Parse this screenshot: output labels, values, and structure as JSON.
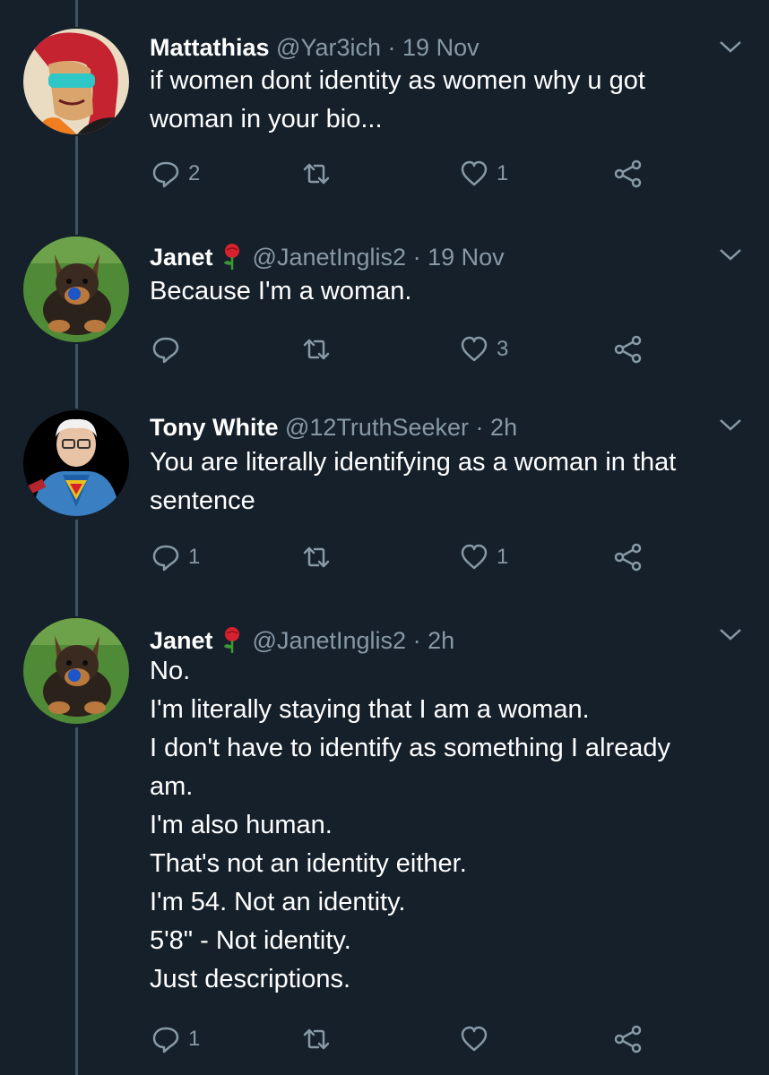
{
  "colors": {
    "background": "#15202b",
    "secondary_text": "#8899a6",
    "thread_line": "#3d5466",
    "primary_text": "#ffffff"
  },
  "tweets": [
    {
      "name": "Mattathias",
      "handle": "@Yar3ich",
      "separator": "·",
      "time": "19 Nov",
      "has_rose": false,
      "avatar": "cartoon-woman-sunglasses-avatar",
      "lines": [
        "if women dont identity as women why u got",
        "woman in your bio..."
      ],
      "actions": {
        "reply_count": "2",
        "retweet_count": "",
        "like_count": "1"
      }
    },
    {
      "name": "Janet",
      "handle": "@JanetInglis2",
      "separator": "·",
      "time": "19 Nov",
      "has_rose": true,
      "avatar": "dog-on-grass-avatar",
      "lines": [
        "Because I'm a woman."
      ],
      "actions": {
        "reply_count": "",
        "retweet_count": "",
        "like_count": "3"
      }
    },
    {
      "name": "Tony White",
      "handle": "@12TruthSeeker",
      "separator": "·",
      "time": "2h",
      "has_rose": false,
      "avatar": "old-man-superman-shirt-avatar",
      "lines": [
        "You are literally identifying as a woman in that",
        "sentence"
      ],
      "actions": {
        "reply_count": "1",
        "retweet_count": "",
        "like_count": "1"
      }
    },
    {
      "name": "Janet",
      "handle": "@JanetInglis2",
      "separator": "·",
      "time": "2h",
      "has_rose": true,
      "avatar": "dog-on-grass-avatar",
      "lines": [
        "No.",
        "I'm literally staying that I am a woman.",
        "I don't have to identify as something I already",
        "am.",
        "I'm also human.",
        "That's not an identity either.",
        "I'm 54. Not an identity.",
        "5'8\" - Not identity.",
        "Just descriptions."
      ],
      "actions": {
        "reply_count": "1",
        "retweet_count": "",
        "like_count": ""
      }
    }
  ]
}
